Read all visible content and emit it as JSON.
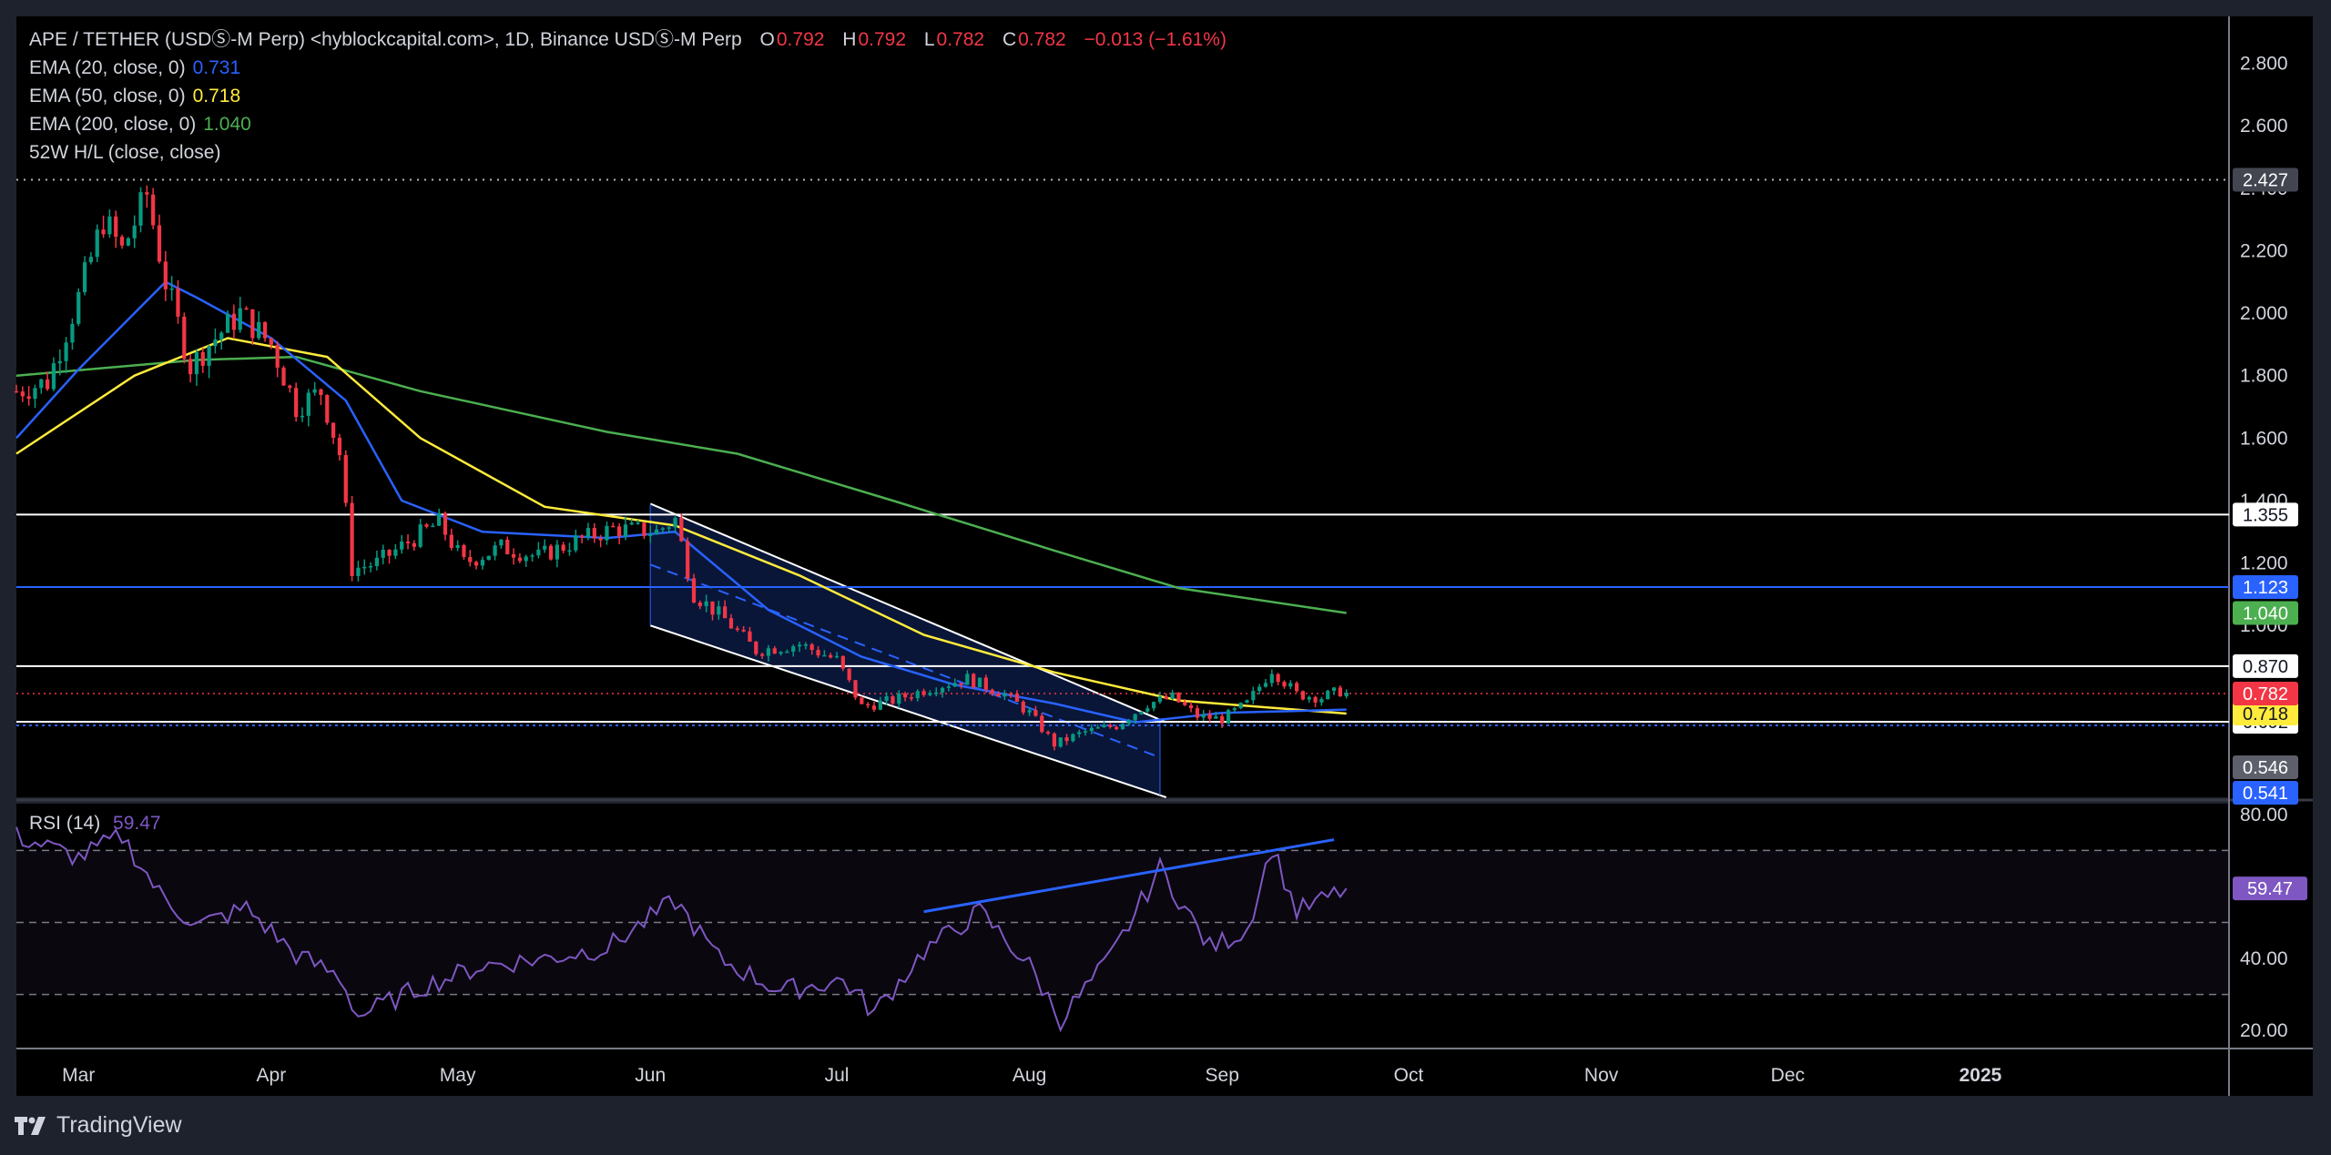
{
  "header": {
    "symbol": "APE / TETHER (USDⓈ-M Perp) <hyblockcapital.com>, 1D, Binance USDⓈ-M Perp",
    "ohlc": [
      {
        "k": "O",
        "v": "0.792"
      },
      {
        "k": "H",
        "v": "0.792"
      },
      {
        "k": "L",
        "v": "0.782"
      },
      {
        "k": "C",
        "v": "0.782"
      }
    ],
    "change": "−0.013 (−1.61%)"
  },
  "indicators": [
    {
      "label": "EMA (20, close, 0)",
      "value": "0.731",
      "color": "#2962ff"
    },
    {
      "label": "EMA (50, close, 0)",
      "value": "0.718",
      "color": "#ffeb3b"
    },
    {
      "label": "EMA (200, close, 0)",
      "value": "1.040",
      "color": "#4caf50"
    },
    {
      "label": "52W H/L (close, close)",
      "value": "",
      "color": "#d1d4dc"
    }
  ],
  "rsi": {
    "label": "RSI (14)",
    "value": "59.47",
    "color": "#7e57c2",
    "badge": "59.47",
    "levels": [
      70,
      50,
      30
    ]
  },
  "footer": {
    "brand": "TradingView"
  },
  "colors": {
    "up": "#089981",
    "down": "#f23645",
    "ema20": "#2962ff",
    "ema50": "#ffeb3b",
    "ema200": "#4caf50",
    "rsi": "#7e57c2"
  },
  "chart_data": {
    "type": "candlestick",
    "title": "APE / TETHER (USDⓈ-M Perp) <hyblockcapital.com>, 1D, Binance USDⓈ-M Perp",
    "price_axis": {
      "ticks": [
        "2.800",
        "2.600",
        "2.400",
        "2.200",
        "2.000",
        "1.800",
        "1.600",
        "1.400",
        "1.200",
        "1.000"
      ],
      "ylim": [
        0.45,
        2.95
      ]
    },
    "rsi_axis": {
      "ticks": [
        "80.00",
        "40.00",
        "20.00"
      ],
      "ylim": [
        15,
        83
      ]
    },
    "time_axis": {
      "labels": [
        {
          "text": "Mar",
          "date": "2024-03-01"
        },
        {
          "text": "Apr",
          "date": "2024-04-01"
        },
        {
          "text": "May",
          "date": "2024-05-01"
        },
        {
          "text": "Jun",
          "date": "2024-06-01"
        },
        {
          "text": "Jul",
          "date": "2024-07-01"
        },
        {
          "text": "Aug",
          "date": "2024-08-01"
        },
        {
          "text": "Sep",
          "date": "2024-09-01"
        },
        {
          "text": "Oct",
          "date": "2024-10-01"
        },
        {
          "text": "Nov",
          "date": "2024-11-01"
        },
        {
          "text": "Dec",
          "date": "2024-12-01"
        },
        {
          "text": "2025",
          "date": "2025-01-01"
        }
      ],
      "xlim": [
        "2024-02-20",
        "2025-02-10"
      ]
    },
    "price_series": [
      {
        "date": "2024-02-20",
        "close": 1.75
      },
      {
        "date": "2024-02-25",
        "close": 1.78
      },
      {
        "date": "2024-03-01",
        "close": 2.05
      },
      {
        "date": "2024-03-05",
        "close": 2.3
      },
      {
        "date": "2024-03-08",
        "close": 2.2
      },
      {
        "date": "2024-03-12",
        "close": 2.38
      },
      {
        "date": "2024-03-15",
        "close": 2.1
      },
      {
        "date": "2024-03-19",
        "close": 1.83
      },
      {
        "date": "2024-03-22",
        "close": 1.9
      },
      {
        "date": "2024-03-27",
        "close": 2.0
      },
      {
        "date": "2024-04-01",
        "close": 1.9
      },
      {
        "date": "2024-04-05",
        "close": 1.7
      },
      {
        "date": "2024-04-09",
        "close": 1.75
      },
      {
        "date": "2024-04-12",
        "close": 1.55
      },
      {
        "date": "2024-04-14",
        "close": 1.18
      },
      {
        "date": "2024-04-18",
        "close": 1.2
      },
      {
        "date": "2024-04-24",
        "close": 1.28
      },
      {
        "date": "2024-04-28",
        "close": 1.33
      },
      {
        "date": "2024-05-02",
        "close": 1.2
      },
      {
        "date": "2024-05-08",
        "close": 1.25
      },
      {
        "date": "2024-05-14",
        "close": 1.22
      },
      {
        "date": "2024-05-20",
        "close": 1.27
      },
      {
        "date": "2024-05-26",
        "close": 1.31
      },
      {
        "date": "2024-06-02",
        "close": 1.3
      },
      {
        "date": "2024-06-05",
        "close": 1.34
      },
      {
        "date": "2024-06-08",
        "close": 1.1
      },
      {
        "date": "2024-06-13",
        "close": 1.02
      },
      {
        "date": "2024-06-18",
        "close": 0.92
      },
      {
        "date": "2024-06-25",
        "close": 0.94
      },
      {
        "date": "2024-07-01",
        "close": 0.89
      },
      {
        "date": "2024-07-05",
        "close": 0.74
      },
      {
        "date": "2024-07-10",
        "close": 0.76
      },
      {
        "date": "2024-07-16",
        "close": 0.8
      },
      {
        "date": "2024-07-22",
        "close": 0.83
      },
      {
        "date": "2024-07-28",
        "close": 0.78
      },
      {
        "date": "2024-08-01",
        "close": 0.72
      },
      {
        "date": "2024-08-05",
        "close": 0.62
      },
      {
        "date": "2024-08-10",
        "close": 0.66
      },
      {
        "date": "2024-08-15",
        "close": 0.68
      },
      {
        "date": "2024-08-20",
        "close": 0.75
      },
      {
        "date": "2024-08-24",
        "close": 0.77
      },
      {
        "date": "2024-08-28",
        "close": 0.71
      },
      {
        "date": "2024-09-01",
        "close": 0.7
      },
      {
        "date": "2024-09-05",
        "close": 0.75
      },
      {
        "date": "2024-09-09",
        "close": 0.86
      },
      {
        "date": "2024-09-13",
        "close": 0.78
      },
      {
        "date": "2024-09-17",
        "close": 0.77
      },
      {
        "date": "2024-09-20",
        "close": 0.79
      },
      {
        "date": "2024-09-21",
        "close": 0.782
      }
    ],
    "ema20": [
      {
        "date": "2024-02-20",
        "v": 1.6
      },
      {
        "date": "2024-03-01",
        "v": 1.82
      },
      {
        "date": "2024-03-15",
        "v": 2.1
      },
      {
        "date": "2024-03-20",
        "v": 2.05
      },
      {
        "date": "2024-04-01",
        "v": 1.92
      },
      {
        "date": "2024-04-13",
        "v": 1.72
      },
      {
        "date": "2024-04-22",
        "v": 1.4
      },
      {
        "date": "2024-05-05",
        "v": 1.3
      },
      {
        "date": "2024-05-25",
        "v": 1.28
      },
      {
        "date": "2024-06-05",
        "v": 1.3
      },
      {
        "date": "2024-06-20",
        "v": 1.05
      },
      {
        "date": "2024-07-05",
        "v": 0.9
      },
      {
        "date": "2024-07-20",
        "v": 0.81
      },
      {
        "date": "2024-08-05",
        "v": 0.75
      },
      {
        "date": "2024-08-18",
        "v": 0.69
      },
      {
        "date": "2024-09-01",
        "v": 0.72
      },
      {
        "date": "2024-09-21",
        "v": 0.731
      }
    ],
    "ema50": [
      {
        "date": "2024-02-20",
        "v": 1.55
      },
      {
        "date": "2024-03-10",
        "v": 1.8
      },
      {
        "date": "2024-03-25",
        "v": 1.92
      },
      {
        "date": "2024-04-10",
        "v": 1.86
      },
      {
        "date": "2024-04-25",
        "v": 1.6
      },
      {
        "date": "2024-05-15",
        "v": 1.38
      },
      {
        "date": "2024-06-05",
        "v": 1.32
      },
      {
        "date": "2024-06-25",
        "v": 1.16
      },
      {
        "date": "2024-07-15",
        "v": 0.97
      },
      {
        "date": "2024-08-05",
        "v": 0.85
      },
      {
        "date": "2024-08-25",
        "v": 0.76
      },
      {
        "date": "2024-09-21",
        "v": 0.718
      }
    ],
    "ema200": [
      {
        "date": "2024-02-20",
        "v": 1.8
      },
      {
        "date": "2024-03-20",
        "v": 1.85
      },
      {
        "date": "2024-04-05",
        "v": 1.86
      },
      {
        "date": "2024-04-25",
        "v": 1.75
      },
      {
        "date": "2024-05-25",
        "v": 1.62
      },
      {
        "date": "2024-06-15",
        "v": 1.55
      },
      {
        "date": "2024-07-10",
        "v": 1.4
      },
      {
        "date": "2024-08-05",
        "v": 1.24
      },
      {
        "date": "2024-08-25",
        "v": 1.12
      },
      {
        "date": "2024-09-21",
        "v": 1.04
      }
    ],
    "horizontal_levels": [
      {
        "value": 1.355,
        "label": "1.355",
        "color": "#ffffff",
        "badge_bg": "#ffffff",
        "badge_fg": "#131722"
      },
      {
        "value": 1.123,
        "label": "1.123",
        "color": "#2962ff",
        "badge_bg": "#2962ff",
        "badge_fg": "#ffffff"
      },
      {
        "value": 0.87,
        "label": "0.870",
        "color": "#ffffff",
        "badge_bg": "#ffffff",
        "badge_fg": "#131722"
      },
      {
        "value": 0.692,
        "label": "0.692",
        "color": "#ffffff",
        "badge_bg": "#ffffff",
        "badge_fg": "#131722"
      }
    ],
    "dashed_levels": [
      {
        "value": 2.427,
        "label": "2.427",
        "badge_bg": "#434651"
      },
      {
        "value": 0.782,
        "label": "0.782",
        "badge_bg": "#f23645"
      },
      {
        "value": 0.541,
        "label": "0.541",
        "badge_bg": "#2962ff"
      }
    ],
    "price_badges": [
      {
        "value": 1.04,
        "label": "1.040",
        "bg": "#4caf50",
        "fg": "#ffffff"
      },
      {
        "value": 0.731,
        "label": "0.731",
        "bg": "#2196f3",
        "fg": "#ffffff"
      },
      {
        "value": 0.718,
        "label": "0.718",
        "bg": "#ffeb3b",
        "fg": "#131722"
      },
      {
        "value": 0.546,
        "label": "0.546",
        "bg": "#5d606b",
        "fg": "#ffffff"
      }
    ],
    "channel": {
      "upper": [
        {
          "date": "2024-06-01",
          "v": 1.39
        },
        {
          "date": "2024-08-23",
          "v": 0.69
        }
      ],
      "lower": [
        {
          "date": "2024-06-01",
          "v": 1.0
        },
        {
          "date": "2024-08-23",
          "v": 0.45
        }
      ],
      "right_edge_date": "2024-08-22"
    },
    "rsi_series": [
      {
        "date": "2024-02-20",
        "v": 74
      },
      {
        "date": "2024-03-01",
        "v": 68
      },
      {
        "date": "2024-03-08",
        "v": 74
      },
      {
        "date": "2024-03-14",
        "v": 58
      },
      {
        "date": "2024-03-20",
        "v": 49
      },
      {
        "date": "2024-03-28",
        "v": 54
      },
      {
        "date": "2024-04-05",
        "v": 41
      },
      {
        "date": "2024-04-12",
        "v": 35
      },
      {
        "date": "2024-04-15",
        "v": 24
      },
      {
        "date": "2024-04-25",
        "v": 32
      },
      {
        "date": "2024-05-05",
        "v": 38
      },
      {
        "date": "2024-05-15",
        "v": 40
      },
      {
        "date": "2024-05-25",
        "v": 43
      },
      {
        "date": "2024-06-05",
        "v": 56
      },
      {
        "date": "2024-06-12",
        "v": 40
      },
      {
        "date": "2024-06-22",
        "v": 31
      },
      {
        "date": "2024-07-02",
        "v": 34
      },
      {
        "date": "2024-07-07",
        "v": 25
      },
      {
        "date": "2024-07-15",
        "v": 42
      },
      {
        "date": "2024-07-24",
        "v": 53
      },
      {
        "date": "2024-08-01",
        "v": 38
      },
      {
        "date": "2024-08-06",
        "v": 23
      },
      {
        "date": "2024-08-14",
        "v": 40
      },
      {
        "date": "2024-08-22",
        "v": 65
      },
      {
        "date": "2024-08-30",
        "v": 43
      },
      {
        "date": "2024-09-05",
        "v": 48
      },
      {
        "date": "2024-09-09",
        "v": 71
      },
      {
        "date": "2024-09-13",
        "v": 53
      },
      {
        "date": "2024-09-17",
        "v": 56
      },
      {
        "date": "2024-09-21",
        "v": 59.47
      }
    ],
    "rsi_trendline": [
      {
        "date": "2024-07-15",
        "v": 53
      },
      {
        "date": "2024-09-19",
        "v": 73
      }
    ]
  }
}
